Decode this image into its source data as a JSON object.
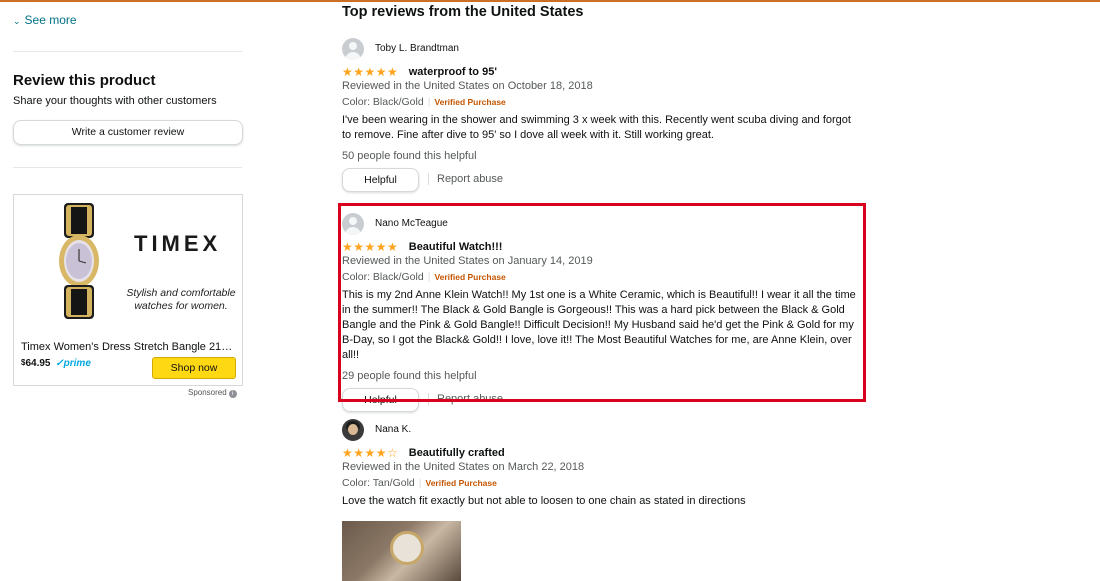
{
  "colors": {
    "star": "#ffa41c",
    "link": "#007185",
    "verified": "#c45500",
    "highlight": "#d8001c",
    "shop_btn": "#ffd814"
  },
  "left": {
    "see_more": "See more",
    "review_title": "Review this product",
    "share_text": "Share your thoughts with other customers",
    "write_review": "Write a customer review",
    "ad": {
      "brand": "TIMEX",
      "tagline": "Stylish and comfortable watches for women.",
      "product": "Timex Women's Dress Stretch Bangle 21m…",
      "price_symbol": "$",
      "price": "64.95",
      "prime": "prime",
      "shop_now": "Shop now",
      "sponsored": "Sponsored"
    }
  },
  "main": {
    "heading": "Top reviews from the United States",
    "reviews": [
      {
        "user": "Toby L. Brandtman",
        "stars": "★★★★★",
        "title": "waterproof to 95'",
        "date": "Reviewed in the United States on October 18, 2018",
        "color": "Color: Black/Gold",
        "verified": "Verified Purchase",
        "body": "I've been wearing in the shower and swimming 3 x week with this. Recently went scuba diving and forgot to remove. Fine after dive to 95' so I dove all week with it. Still working great.",
        "helpful_count": "50 people found this helpful",
        "helpful_btn": "Helpful",
        "report": "Report abuse"
      },
      {
        "user": "Nano McTeague",
        "stars": "★★★★★",
        "title": "Beautiful Watch!!!",
        "date": "Reviewed in the United States on January 14, 2019",
        "color": "Color: Black/Gold",
        "verified": "Verified Purchase",
        "body": "This is my 2nd Anne Klein Watch!! My 1st one is a White Ceramic, which is Beautiful!! I wear it all the time in the summer!! The Black & Gold Bangle is Gorgeous!! This was a hard pick between the Black & Gold Bangle and the Pink & Gold Bangle!! Difficult Decision!! My Husband said he'd get the Pink & Gold for my B-Day, so I got the Black& Gold!! I love, love it!! The Most Beautiful Watches for me, are Anne Klein, over all!!",
        "helpful_count": "29 people found this helpful",
        "helpful_btn": "Helpful",
        "report": "Report abuse"
      },
      {
        "user": "Nana K.",
        "stars_filled": "★★★★",
        "stars_empty": "☆",
        "title": "Beautifully crafted",
        "date": "Reviewed in the United States on March 22, 2018",
        "color": "Color: Tan/Gold",
        "verified": "Verified Purchase",
        "body": "Love the watch fit exactly but not able to loosen to one chain as stated in directions"
      }
    ]
  }
}
